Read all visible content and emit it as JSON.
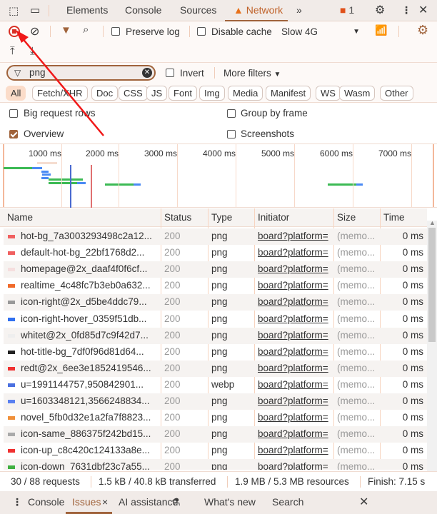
{
  "tabs": {
    "items": [
      "Elements",
      "Console",
      "Sources",
      "Network"
    ],
    "active": "Network",
    "issues_count": "1"
  },
  "toolbar": {
    "preserve_log": "Preserve log",
    "disable_cache": "Disable cache",
    "throttle": "Slow 4G"
  },
  "filter": {
    "value": "png",
    "invert": "Invert",
    "more_filters": "More filters"
  },
  "types": [
    "All",
    "Fetch/XHR",
    "Doc",
    "CSS",
    "JS",
    "Font",
    "Img",
    "Media",
    "Manifest",
    "WS",
    "Wasm",
    "Other"
  ],
  "options": {
    "big_rows": "Big request rows",
    "group_frame": "Group by frame",
    "overview": "Overview",
    "screenshots": "Screenshots"
  },
  "overview": {
    "ticks": [
      "1000 ms",
      "2000 ms",
      "3000 ms",
      "4000 ms",
      "5000 ms",
      "6000 ms",
      "7000 ms"
    ]
  },
  "table": {
    "headers": [
      "Name",
      "Status",
      "Type",
      "Initiator",
      "Size",
      "Time"
    ],
    "rows": [
      {
        "name": "hot-bg_7a3003293498c2a12...",
        "status": "200",
        "type": "png",
        "initiator": "board?platform=",
        "size": "(memo...",
        "time": "0 ms",
        "icon": "#f06060"
      },
      {
        "name": "default-hot-bg_22bf1768d2...",
        "status": "200",
        "type": "png",
        "initiator": "board?platform=",
        "size": "(memo...",
        "time": "0 ms",
        "icon": "#f06060"
      },
      {
        "name": "homepage@2x_daaf4f0f6cf...",
        "status": "200",
        "type": "png",
        "initiator": "board?platform=",
        "size": "(memo...",
        "time": "0 ms",
        "icon": "#f5dede"
      },
      {
        "name": "realtime_4c48fc7b3eb0a632...",
        "status": "200",
        "type": "png",
        "initiator": "board?platform=",
        "size": "(memo...",
        "time": "0 ms",
        "icon": "#f06a2a"
      },
      {
        "name": "icon-right@2x_d5be4ddc79...",
        "status": "200",
        "type": "png",
        "initiator": "board?platform=",
        "size": "(memo...",
        "time": "0 ms",
        "icon": "#999999"
      },
      {
        "name": "icon-right-hover_0359f51db...",
        "status": "200",
        "type": "png",
        "initiator": "board?platform=",
        "size": "(memo...",
        "time": "0 ms",
        "icon": "#3070f0"
      },
      {
        "name": "whitet@2x_0fd85d7c9f42d7...",
        "status": "200",
        "type": "png",
        "initiator": "board?platform=",
        "size": "(memo...",
        "time": "0 ms",
        "icon": "#eeeeee"
      },
      {
        "name": "hot-title-bg_7df0f96d81d64...",
        "status": "200",
        "type": "png",
        "initiator": "board?platform=",
        "size": "(memo...",
        "time": "0 ms",
        "icon": "#222222"
      },
      {
        "name": "redt@2x_6ee3e1852419546...",
        "status": "200",
        "type": "png",
        "initiator": "board?platform=",
        "size": "(memo...",
        "time": "0 ms",
        "icon": "#f03030"
      },
      {
        "name": "u=1991144757,950842901...",
        "status": "200",
        "type": "webp",
        "initiator": "board?platform=",
        "size": "(memo...",
        "time": "0 ms",
        "icon": "#4a70e0"
      },
      {
        "name": "u=1603348121,3566248834...",
        "status": "200",
        "type": "png",
        "initiator": "board?platform=",
        "size": "(memo...",
        "time": "0 ms",
        "icon": "#5a80f0"
      },
      {
        "name": "novel_5fb0d32e1a2fa7f8823...",
        "status": "200",
        "type": "png",
        "initiator": "board?platform=",
        "size": "(memo...",
        "time": "0 ms",
        "icon": "#f0903a"
      },
      {
        "name": "icon-same_886375f242bd15...",
        "status": "200",
        "type": "png",
        "initiator": "board?platform=",
        "size": "(memo...",
        "time": "0 ms",
        "icon": "#aaaaaa"
      },
      {
        "name": "icon-up_c8c420c124133a8e...",
        "status": "200",
        "type": "png",
        "initiator": "board?platform=",
        "size": "(memo...",
        "time": "0 ms",
        "icon": "#f03030"
      },
      {
        "name": "icon-down_7631dbf23c7a55...",
        "status": "200",
        "type": "png",
        "initiator": "board?platform=",
        "size": "(memo...",
        "time": "0 ms",
        "icon": "#40b040"
      }
    ]
  },
  "statusbar": {
    "requests": "30 / 88 requests",
    "transferred": "1.5 kB / 40.8 kB transferred",
    "resources": "1.9 MB / 5.3 MB resources",
    "finish": "Finish: 7.15 s"
  },
  "drawer": {
    "tabs": [
      "Console",
      "Issues",
      "AI assistance",
      "What's new",
      "Search"
    ],
    "active": "Issues"
  },
  "colors": {
    "accent": "#c0622a",
    "record": "#d93025",
    "annotation_arrow": "#f01818"
  }
}
